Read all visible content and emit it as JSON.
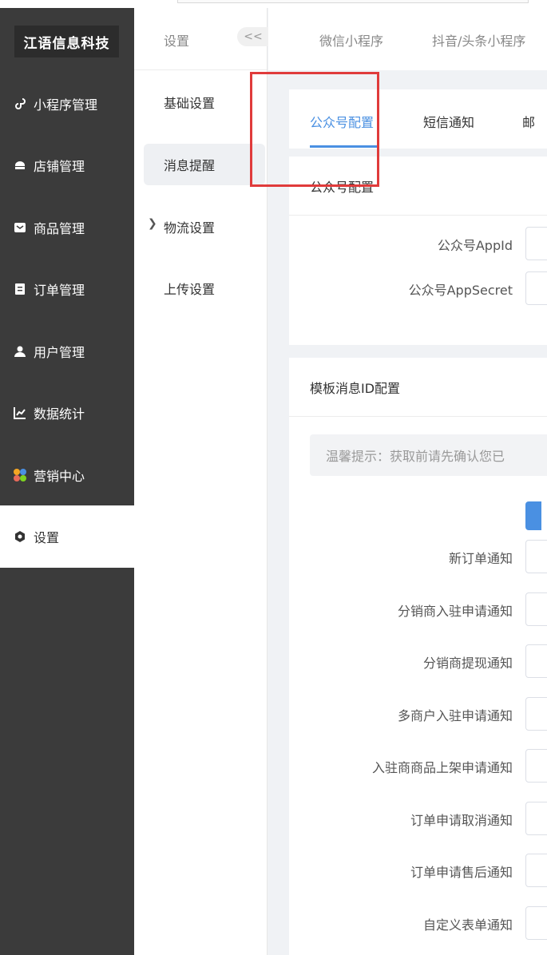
{
  "brand": {
    "name": "江语信息科技"
  },
  "sidebar": {
    "items": [
      {
        "label": "小程序管理",
        "icon": "mini-program-icon"
      },
      {
        "label": "店铺管理",
        "icon": "shop-icon"
      },
      {
        "label": "商品管理",
        "icon": "goods-icon"
      },
      {
        "label": "订单管理",
        "icon": "order-icon"
      },
      {
        "label": "用户管理",
        "icon": "user-icon"
      },
      {
        "label": "数据统计",
        "icon": "chart-icon"
      },
      {
        "label": "营销中心",
        "icon": "marketing-icon"
      },
      {
        "label": "设置",
        "icon": "settings-icon",
        "active": true
      }
    ]
  },
  "submenu": {
    "title": "设置",
    "collapse_label": "<<",
    "items": [
      {
        "label": "基础设置"
      },
      {
        "label": "消息提醒",
        "active": true
      },
      {
        "label": "物流设置",
        "expandable": true
      },
      {
        "label": "上传设置"
      }
    ]
  },
  "platform_tabs": [
    {
      "label": "微信小程序"
    },
    {
      "label": "抖音/头条小程序"
    }
  ],
  "message_tabs": [
    {
      "label": "公众号配置",
      "active": true
    },
    {
      "label": "短信通知"
    },
    {
      "label": "邮"
    }
  ],
  "official_account": {
    "title": "公众号配置",
    "fields": [
      {
        "label": "公众号AppId",
        "value": ""
      },
      {
        "label": "公众号AppSecret",
        "value": ""
      }
    ]
  },
  "template_config": {
    "title": "模板消息ID配置",
    "tip": "温馨提示：获取前请先确认您已",
    "fields": [
      {
        "label": "新订单通知",
        "value": ""
      },
      {
        "label": "分销商入驻申请通知",
        "value": ""
      },
      {
        "label": "分销商提现通知",
        "value": ""
      },
      {
        "label": "多商户入驻申请通知",
        "value": ""
      },
      {
        "label": "入驻商商品上架申请通知",
        "value": ""
      },
      {
        "label": "订单申请取消通知",
        "value": ""
      },
      {
        "label": "订单申请售后通知",
        "value": ""
      },
      {
        "label": "自定义表单通知",
        "value": ""
      }
    ]
  },
  "colors": {
    "sidebar_bg": "#3b3b3b",
    "accent": "#4a90e2",
    "highlight": "#e03b3b"
  }
}
